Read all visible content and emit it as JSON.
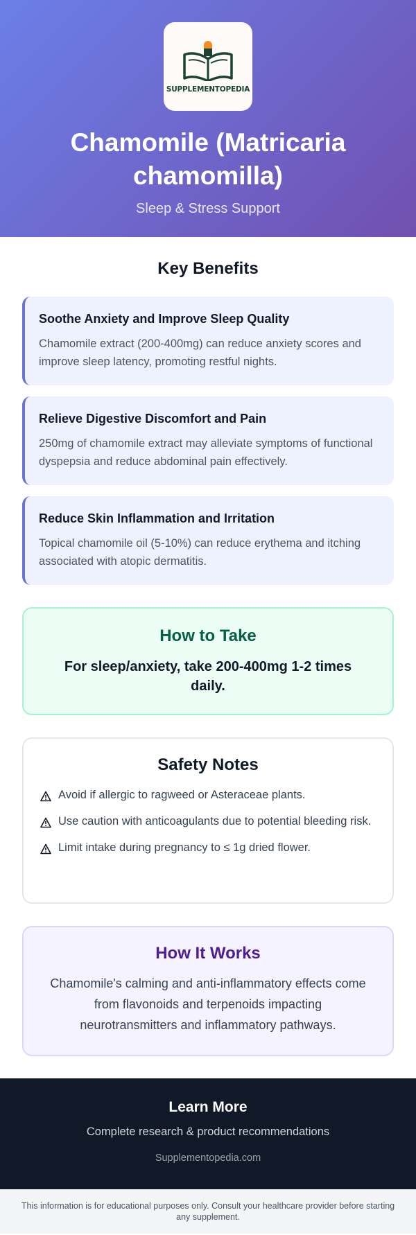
{
  "header": {
    "logo_text": "SUPPLEMENTOPEDIA",
    "title": "Chamomile (Matricaria chamomilla)",
    "subtitle": "Sleep & Stress Support"
  },
  "benefits": {
    "heading": "Key Benefits",
    "items": [
      {
        "title": "Soothe Anxiety and Improve Sleep Quality",
        "desc": "Chamomile extract (200-400mg) can reduce anxiety scores and improve sleep latency, promoting restful nights."
      },
      {
        "title": "Relieve Digestive Discomfort and Pain",
        "desc": "250mg of chamomile extract may alleviate symptoms of functional dyspepsia and reduce abdominal pain effectively."
      },
      {
        "title": "Reduce Skin Inflammation and Irritation",
        "desc": "Topical chamomile oil (5-10%) can reduce erythema and itching associated with atopic dermatitis."
      }
    ]
  },
  "how_to_take": {
    "title": "How to Take",
    "text": "For sleep/anxiety, take 200-400mg 1-2 times daily."
  },
  "safety": {
    "title": "Safety Notes",
    "items": [
      "Avoid if allergic to ragweed or Asteraceae plants.",
      "Use caution with anticoagulants due to potential bleeding risk.",
      "Limit intake during pregnancy to ≤ 1g dried flower."
    ]
  },
  "how_it_works": {
    "title": "How It Works",
    "text": "Chamomile's calming and anti-inflammatory effects come from flavonoids and terpenoids impacting neurotransmitters and inflammatory pathways."
  },
  "learn_more": {
    "title": "Learn More",
    "subtitle": "Complete research & product recommendations",
    "link": "Supplementopedia.com"
  },
  "footer": {
    "disclaimer": "This information is for educational purposes only. Consult your healthcare provider before starting any supplement."
  },
  "colors": {
    "header_gradient_start": "#6b7fe8",
    "header_gradient_end": "#7150b0",
    "benefit_accent": "#6b73d6",
    "howto_bg": "#ecfdf5",
    "works_bg": "#f5f3ff",
    "learn_bg": "#111827"
  },
  "icons": {
    "logo": "book-capsule-icon",
    "warning": "warning-triangle-icon"
  }
}
